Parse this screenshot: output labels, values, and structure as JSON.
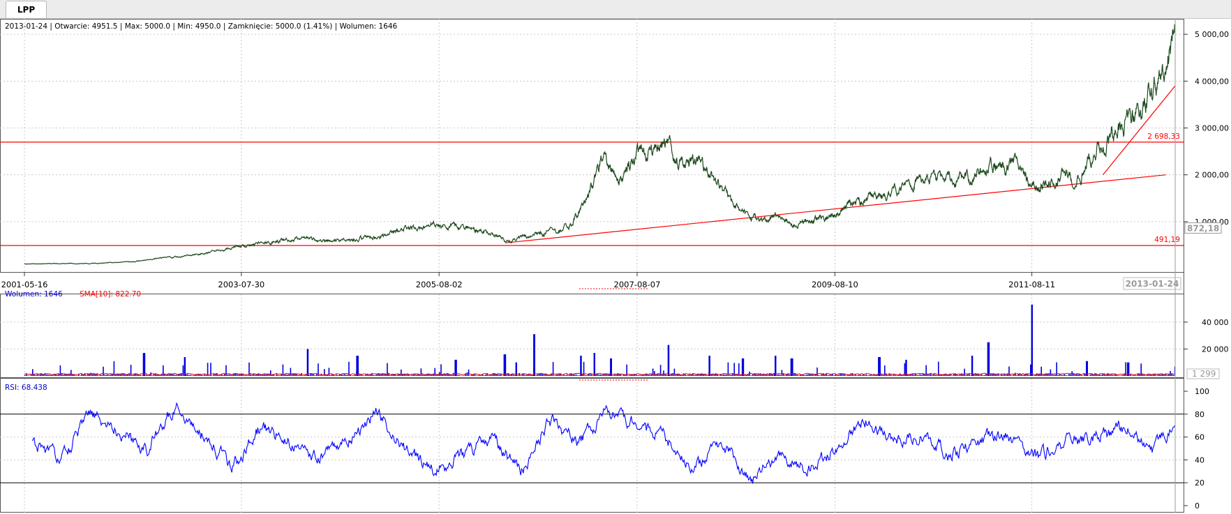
{
  "tab": {
    "label": "LPP"
  },
  "info": {
    "price_line": "2013-01-24 | Otwarcie: 4951.5 | Max: 5000.0 | Min: 4950.0 | Zamknięcie: 5000.0 (1.41%)  | Wolumen: 1646",
    "volume_label": "Wolumen: 1646",
    "sma_label": "SMA[10]: 822.70",
    "rsi_label": "RSI: 68.438"
  },
  "colors": {
    "price": "#1e4a1e",
    "hline": "#ff0000",
    "volume": "#0000dd",
    "sma": "#ff0000",
    "rsi": "#0000ff",
    "grid": "#c8c8c8"
  },
  "chart_data": [
    {
      "type": "line",
      "panel": "price",
      "x_type": "date",
      "xlim": [
        "2001-05-16",
        "2013-01-24"
      ],
      "ylim": [
        0,
        5300
      ],
      "x_ticks": [
        "2001-05-16",
        "2003-07-30",
        "2005-08-02",
        "2007-08-07",
        "2009-08-10",
        "2011-08-11"
      ],
      "x_cursor_label": "2013-01-24",
      "y_ticks": [
        1000,
        2000,
        3000,
        4000,
        5000
      ],
      "y_tick_labels": [
        "1 000,00",
        "2 000,00",
        "3 000,00",
        "4 000,00",
        "5 000,00"
      ],
      "y_cursor_label": "872,18",
      "grid": true,
      "series": [
        {
          "x": [
            "2001-05-16",
            "2002-01-15",
            "2002-07-01",
            "2002-11-01",
            "2003-03-01",
            "2003-07-30",
            "2004-01-15",
            "2004-07-01",
            "2004-12-01",
            "2005-04-01",
            "2005-08-02",
            "2006-01-01",
            "2006-04-10",
            "2006-07-15",
            "2006-12-01",
            "2007-02-01",
            "2007-04-01",
            "2007-06-01",
            "2007-08-07",
            "2007-10-01",
            "2007-11-20",
            "2008-01-15",
            "2008-03-01",
            "2008-05-15",
            "2008-08-01",
            "2008-10-27",
            "2009-01-01",
            "2009-03-01",
            "2009-05-15",
            "2009-08-10",
            "2009-10-01",
            "2010-01-01",
            "2010-04-01",
            "2010-07-01",
            "2010-10-01",
            "2011-01-01",
            "2011-03-01",
            "2011-06-01",
            "2011-08-11",
            "2011-09-20",
            "2011-12-01",
            "2012-02-01",
            "2012-04-01",
            "2012-06-01",
            "2012-08-01",
            "2012-09-20",
            "2012-11-01",
            "2013-01-24"
          ],
          "y": [
            100,
            110,
            150,
            230,
            300,
            460,
            620,
            600,
            680,
            850,
            960,
            830,
            580,
            700,
            900,
            1500,
            2400,
            2000,
            2400,
            2500,
            2650,
            2200,
            2300,
            1900,
            1300,
            1000,
            1150,
            950,
            1050,
            1100,
            1350,
            1500,
            1700,
            1900,
            1850,
            2000,
            2200,
            2250,
            1750,
            1800,
            2000,
            1950,
            2600,
            2800,
            3200,
            3300,
            3900,
            4950
          ]
        }
      ],
      "horizontal_lines": [
        {
          "value": 2698.33,
          "label": "2 698,33"
        },
        {
          "value": 491.19,
          "label": "491,19"
        }
      ],
      "trend_lines": [
        {
          "from": [
            "2006-04-10",
            550
          ],
          "to": [
            "2012-12-20",
            2000
          ]
        },
        {
          "from": [
            "2012-05-01",
            2000
          ],
          "to": [
            "2013-01-24",
            3900
          ]
        }
      ]
    },
    {
      "type": "bar",
      "panel": "volume",
      "ylim": [
        0,
        56000
      ],
      "y_ticks": [
        20000,
        40000
      ],
      "y_tick_labels": [
        "20 000",
        "40 000"
      ],
      "y_cursor_label": "1 299",
      "series": [
        {
          "name": "Wolumen",
          "x_spikes": [
            "2002-08-01",
            "2003-01-01",
            "2004-04-01",
            "2004-10-01",
            "2005-10-01",
            "2006-04-01",
            "2006-05-15",
            "2006-07-20",
            "2007-01-10",
            "2007-03-01",
            "2007-05-01",
            "2007-12-01",
            "2008-05-01",
            "2008-09-01",
            "2009-01-01",
            "2009-03-01",
            "2010-01-20",
            "2010-05-01",
            "2011-01-01",
            "2011-03-01",
            "2011-08-11",
            "2012-03-01",
            "2012-08-01"
          ],
          "values": [
            17000,
            14000,
            20000,
            15000,
            12000,
            16000,
            10000,
            31000,
            15000,
            17000,
            13000,
            23000,
            15000,
            13000,
            15000,
            13000,
            14000,
            12000,
            15000,
            25000,
            53000,
            11000,
            10000
          ]
        },
        {
          "name": "SMA[10]",
          "value_approx": 1300
        }
      ]
    },
    {
      "type": "line",
      "panel": "rsi",
      "ylim": [
        0,
        100
      ],
      "y_ticks": [
        0,
        20,
        40,
        60,
        80,
        100
      ],
      "y_tick_labels": [
        "0",
        "20",
        "40",
        "60",
        "80",
        "100"
      ],
      "reference_lines": [
        20,
        80
      ],
      "series": [
        {
          "name": "RSI",
          "x": [
            "2001-06-15",
            "2001-10-01",
            "2002-01-15",
            "2002-05-01",
            "2002-08-15",
            "2002-12-01",
            "2003-03-15",
            "2003-07-01",
            "2003-10-15",
            "2004-02-01",
            "2004-05-15",
            "2004-09-01",
            "2004-12-15",
            "2005-04-01",
            "2005-07-15",
            "2005-11-01",
            "2006-02-15",
            "2006-06-01",
            "2006-09-15",
            "2007-01-01",
            "2007-04-15",
            "2007-08-01",
            "2007-11-15",
            "2008-03-01",
            "2008-06-15",
            "2008-10-01",
            "2009-01-15",
            "2009-05-01",
            "2009-08-15",
            "2009-12-01",
            "2010-03-15",
            "2010-07-01",
            "2010-10-15",
            "2011-02-01",
            "2011-05-15",
            "2011-09-01",
            "2011-12-15",
            "2012-04-01",
            "2012-07-15",
            "2012-11-01",
            "2013-01-24"
          ],
          "y": [
            55,
            40,
            80,
            65,
            50,
            88,
            60,
            35,
            70,
            55,
            42,
            60,
            80,
            50,
            30,
            45,
            60,
            28,
            75,
            55,
            82,
            70,
            60,
            30,
            55,
            20,
            45,
            30,
            50,
            75,
            55,
            60,
            45,
            58,
            62,
            42,
            55,
            60,
            68,
            50,
            68
          ]
        }
      ]
    }
  ]
}
